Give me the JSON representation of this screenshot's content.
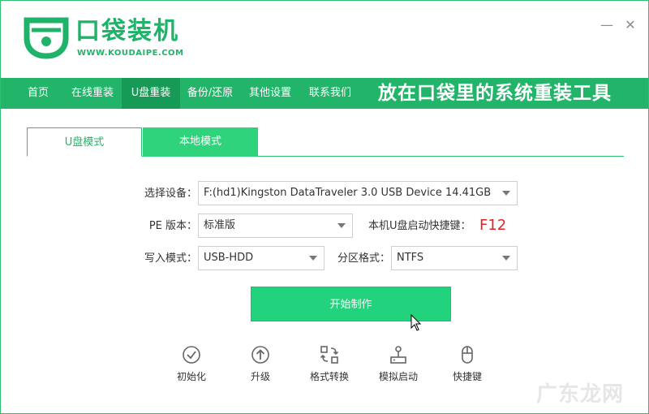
{
  "header": {
    "brand_name": "口袋装机",
    "brand_url": "WWW.KOUDAIPE.COM",
    "minimize_label": "—",
    "close_label": "✕"
  },
  "nav": {
    "items": [
      {
        "label": "首页"
      },
      {
        "label": "在线重装"
      },
      {
        "label": "U盘重装"
      },
      {
        "label": "备份/还原"
      },
      {
        "label": "其他设置"
      },
      {
        "label": "联系我们"
      }
    ],
    "active_index": 2,
    "slogan": "放在口袋里的系统重装工具"
  },
  "mode_tabs": [
    {
      "label": "U盘模式"
    },
    {
      "label": "本地模式"
    }
  ],
  "form": {
    "device_label": "选择设备：",
    "device_value": "F:(hd1)Kingston DataTraveler 3.0 USB Device 14.41GB",
    "pe_label": "PE 版本：",
    "pe_value": "标准版",
    "hotkey_label": "本机U盘启动快捷键：",
    "hotkey_value": "F12",
    "write_label": "写入模式：",
    "write_value": "USB-HDD",
    "partition_label": "分区格式：",
    "partition_value": "NTFS"
  },
  "start_button": "开始制作",
  "tools": [
    {
      "label": "初始化",
      "icon": "check-circle-icon"
    },
    {
      "label": "升级",
      "icon": "upload-circle-icon"
    },
    {
      "label": "格式转换",
      "icon": "convert-icon"
    },
    {
      "label": "模拟启动",
      "icon": "joystick-icon"
    },
    {
      "label": "快捷键",
      "icon": "mouse-icon"
    }
  ],
  "watermark": "广东龙网",
  "colors": {
    "brand_green": "#22b56a",
    "active_nav": "#179a56",
    "start_button": "#22d27c",
    "hotkey_red": "#e02424"
  }
}
